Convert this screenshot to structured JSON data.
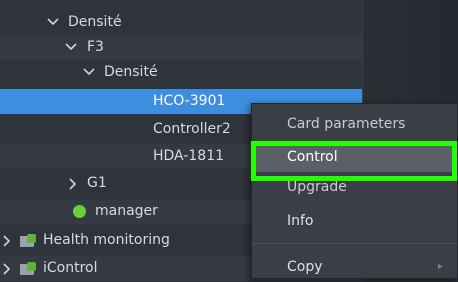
{
  "tree": {
    "rows": [
      {
        "label": "Densité"
      },
      {
        "label": "F3"
      },
      {
        "label": "Densité"
      },
      {
        "label": "HCO-3901"
      },
      {
        "label": "Controller2"
      },
      {
        "label": "HDA-1811"
      },
      {
        "label": "G1"
      },
      {
        "label": "manager"
      },
      {
        "label": "Health monitoring"
      },
      {
        "label": "iControl"
      }
    ]
  },
  "context_menu": {
    "items": [
      "Card parameters",
      "Control",
      "Upgrade",
      "Info",
      "Copy"
    ],
    "highlighted": "Control"
  },
  "colors": {
    "selection": "#3d8de0",
    "callout": "#22ff00",
    "status_dot": "#6fcf3a"
  }
}
